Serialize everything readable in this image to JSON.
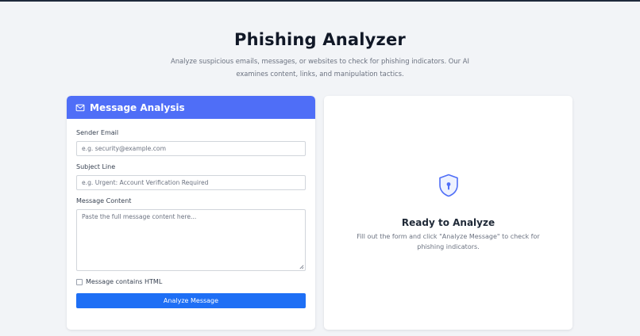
{
  "header": {
    "title": "Phishing Analyzer",
    "subtitle": "Analyze suspicious emails, messages, or websites to check for phishing indicators. Our AI examines content, links, and manipulation tactics."
  },
  "form": {
    "title": "Message Analysis",
    "title_icon": "envelope-icon",
    "sender": {
      "label": "Sender Email",
      "placeholder": "e.g. security@example.com",
      "value": ""
    },
    "subject": {
      "label": "Subject Line",
      "placeholder": "e.g. Urgent: Account Verification Required",
      "value": ""
    },
    "content": {
      "label": "Message Content",
      "placeholder": "Paste the full message content here...",
      "value": ""
    },
    "html_checkbox": {
      "label": "Message contains HTML",
      "checked": false
    },
    "submit_label": "Analyze Message"
  },
  "result": {
    "icon": "shield-lock-icon",
    "title": "Ready to Analyze",
    "text": "Fill out the form and click \"Analyze Message\" to check for phishing indicators."
  },
  "colors": {
    "accent": "#4f6ef7",
    "button": "#1e6ff5",
    "background": "#f2f4f7"
  }
}
